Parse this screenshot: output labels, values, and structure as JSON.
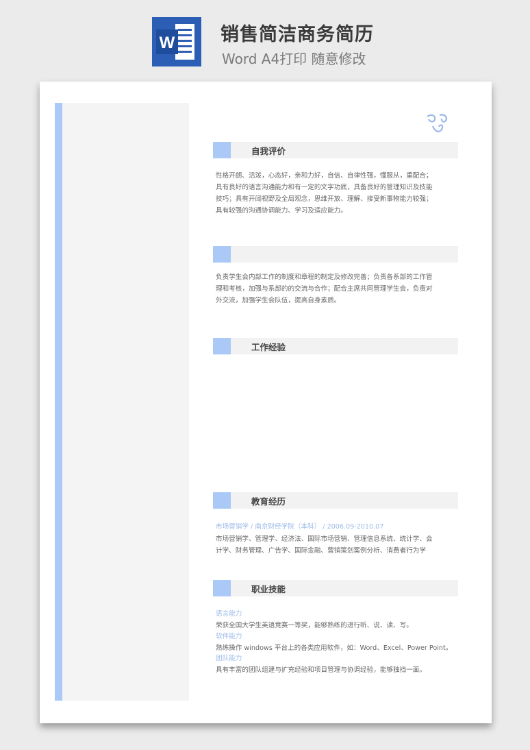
{
  "header": {
    "title": "销售简洁商务简历",
    "subtitle": "Word A4打印 随意修改",
    "icon_letter": "W",
    "icon_color": "#2b5eb4"
  },
  "accent_color": "#aac9f7",
  "sections": {
    "self_eval": {
      "title": "自我评价",
      "lines": [
        "性格开朗、活泼，心态好，亲和力好，自信、自律性强，懂服从，重配合；",
        "具有良好的语言沟通能力和有一定的文字功底，具备良好的管理知识及技能",
        "技巧；具有开阔视野及全局观念，思维开放、理解、接受新事物能力较强；",
        "具有较强的沟通协调能力、学习及适应能力。"
      ]
    },
    "campus": {
      "title": "",
      "lines": [
        "负责学生会内部工作的制度和章程的制定及修改完善；负责各系部的工作管",
        "理和考核，加强与系部的的交流与合作；配合主席共同管理学生会，负责对",
        "外交流，加强学生会队伍，提高自身素质。"
      ]
    },
    "work": {
      "title": "工作经验"
    },
    "education": {
      "title": "教育经历",
      "summary": "市场营销学 / 南京财经学院（本科） / 2006.09-2010.07",
      "lines": [
        "市场营销学、管理学、经济法、国际市场营销、管理信息系统、统计学、会",
        "计学、财务管理、广告学、国际金融、营销策划案例分析、消费者行为学"
      ]
    },
    "skills": {
      "title": "职业技能",
      "items": [
        {
          "name": "语言能力",
          "desc": "荣获全国大学生英语竞赛一等奖，能够熟练的进行听、说、读、写。"
        },
        {
          "name": "软件能力",
          "desc": "熟练操作 windows 平台上的各类应用软件，如：Word、Excel、Power Point。"
        },
        {
          "name": "团队能力",
          "desc": "具有丰富的团队组建与扩充经验和项目管理与协调经验，能够独挡一面。"
        }
      ]
    }
  }
}
